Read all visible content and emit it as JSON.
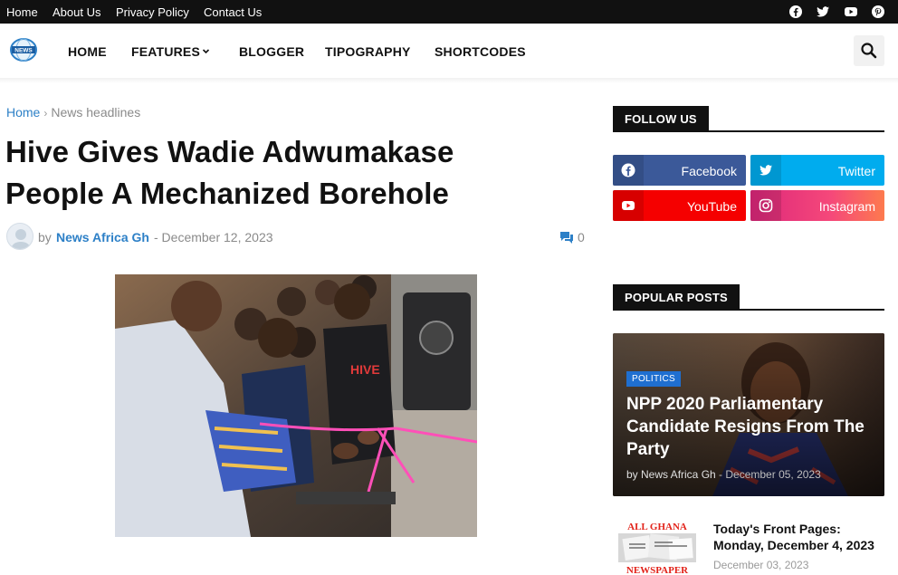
{
  "topbar": {
    "links": [
      "Home",
      "About Us",
      "Privacy Policy",
      "Contact Us"
    ],
    "social_icons": [
      "facebook-icon",
      "twitter-icon",
      "youtube-icon",
      "pinterest-icon"
    ]
  },
  "header": {
    "logo_text": "NEWS",
    "nav": [
      "HOME",
      "FEATURES",
      "BLOGGER",
      "TIPOGRAPHY",
      "SHORTCODES"
    ]
  },
  "breadcrumb": {
    "home": "Home",
    "separator": "›",
    "current": "News headlines"
  },
  "article": {
    "title": "Hive Gives Wadie Adwumakase People A Mechanized Borehole",
    "by": "by",
    "author": "News Africa Gh",
    "date": "- December 12, 2023",
    "comment_count": "0",
    "image_text": "HIVE"
  },
  "sidebar": {
    "follow_heading": "FOLLOW US",
    "social": [
      {
        "label": "Facebook",
        "color": "#3b5999"
      },
      {
        "label": "Twitter",
        "color": "#00acee"
      },
      {
        "label": "YouTube",
        "color": "#f50000"
      },
      {
        "label": "Instagram",
        "color": "#dd277b"
      }
    ],
    "popular_heading": "POPULAR POSTS",
    "featured": {
      "tag": "POLITICS",
      "title": "NPP 2020 Parliamentary Candidate Resigns From The Party",
      "author": "by News Africa Gh",
      "date": "- December 05, 2023"
    },
    "post": {
      "thumb_text_top": "ALL GHANA",
      "thumb_text_bottom": "NEWSPAPER",
      "title": "Today's Front Pages: Monday, December 4, 2023",
      "date": "December 03, 2023"
    }
  },
  "colors": {
    "accent": "#2d80c7",
    "dark": "#111111",
    "tag": "#1f6fd0"
  }
}
